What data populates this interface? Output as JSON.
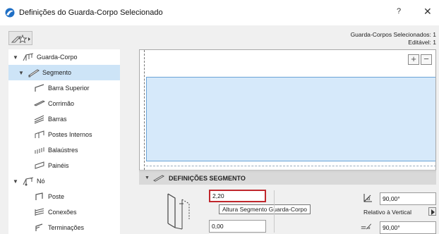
{
  "window": {
    "title": "Definições do Guarda-Corpo Selecionado",
    "help_label": "?",
    "close_label": "✕"
  },
  "selection_info": {
    "line1": "Guarda-Corpos Selecionados: 1",
    "line2": "Editável: 1"
  },
  "tree": {
    "items": [
      {
        "label": "Guarda-Corpo",
        "level": 0,
        "expanded": true,
        "selected": false,
        "icon": "railing-icon"
      },
      {
        "label": "Segmento",
        "level": 1,
        "expanded": true,
        "selected": true,
        "icon": "segment-icon"
      },
      {
        "label": "Barra Superior",
        "level": 2,
        "selected": false,
        "icon": "top-rail-icon"
      },
      {
        "label": "Corrimão",
        "level": 2,
        "selected": false,
        "icon": "handrail-icon"
      },
      {
        "label": "Barras",
        "level": 2,
        "selected": false,
        "icon": "rails-icon"
      },
      {
        "label": "Postes Internos",
        "level": 2,
        "selected": false,
        "icon": "inner-posts-icon"
      },
      {
        "label": "Balaústres",
        "level": 2,
        "selected": false,
        "icon": "balusters-icon"
      },
      {
        "label": "Painéis",
        "level": 2,
        "selected": false,
        "icon": "panels-icon"
      },
      {
        "label": "Nó",
        "level": 0,
        "expanded": true,
        "selected": false,
        "icon": "node-icon"
      },
      {
        "label": "Poste",
        "level": 2,
        "selected": false,
        "icon": "post-icon"
      },
      {
        "label": "Conexões",
        "level": 2,
        "selected": false,
        "icon": "connections-icon"
      },
      {
        "label": "Terminações",
        "level": 2,
        "selected": false,
        "icon": "endings-icon"
      }
    ]
  },
  "preview": {
    "zoom_in_label": "+",
    "zoom_out_label": "−"
  },
  "section": {
    "title": "DEFINIÇÕES SEGMENTO"
  },
  "fields": {
    "segment_height": "2,20",
    "segment_height_tooltip": "Altura Segmento Guarda-Corpo",
    "offset": "0,00",
    "angle1": "90,00°",
    "angle2": "90,00°",
    "relative_label": "Relativo à Vertical"
  },
  "colors": {
    "selected_item": "#cde4f7",
    "preview_fill": "#d6e9fa",
    "active_field_border": "#c0272d"
  }
}
